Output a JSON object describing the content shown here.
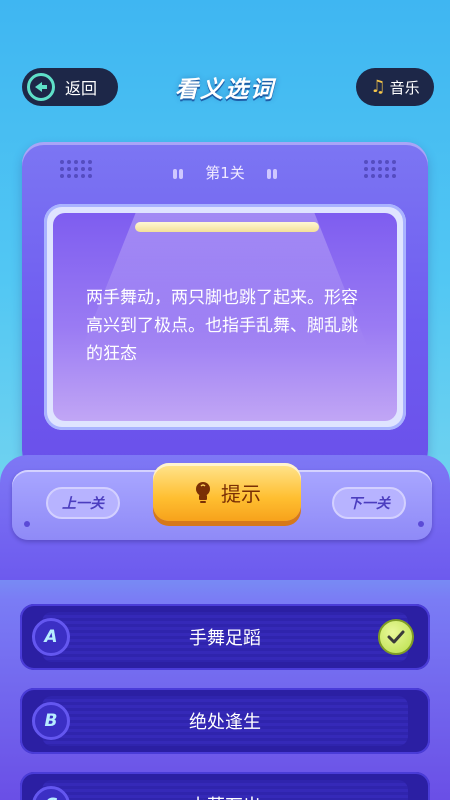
{
  "header": {
    "back_label": "返回",
    "title": "看义选词",
    "music_label": "音乐",
    "music_icon": "music-note-icon"
  },
  "level": {
    "label": "第1关"
  },
  "riddle": {
    "text": "两手舞动，两只脚也跳了起来。形容高兴到了极点。也指手乱舞、脚乱跳的狂态"
  },
  "controls": {
    "prev_label": "上一关",
    "hint_label": "提示",
    "next_label": "下一关"
  },
  "options": [
    {
      "letter": "A",
      "text": "手舞足蹈",
      "selected": true
    },
    {
      "letter": "B",
      "text": "绝处逢生",
      "selected": false
    },
    {
      "letter": "C",
      "text": "水落石出",
      "selected": false
    }
  ],
  "colors": {
    "accent_teal": "#5fe0c9",
    "hint_yellow": "#ffbf31",
    "option_bg": "#2b1fa3",
    "check_green": "#b9df4a"
  }
}
